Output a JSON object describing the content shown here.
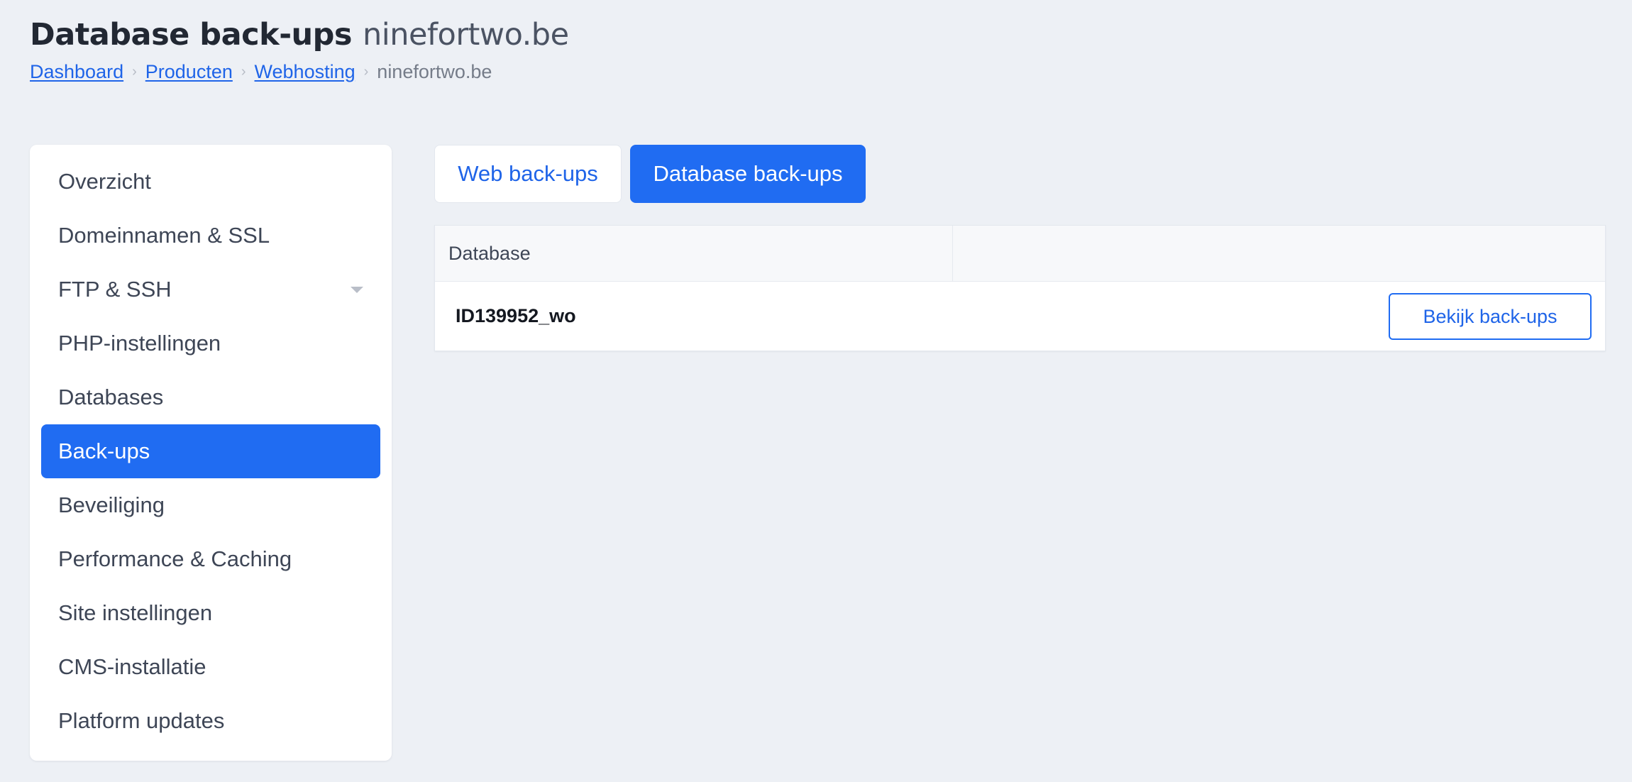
{
  "header": {
    "title": "Database back-ups",
    "domain": "ninefortwo.be"
  },
  "breadcrumb": {
    "items": [
      "Dashboard",
      "Producten",
      "Webhosting"
    ],
    "current": "ninefortwo.be",
    "separator": "›"
  },
  "sidebar": {
    "items": [
      {
        "label": "Overzicht"
      },
      {
        "label": "Domeinnamen & SSL"
      },
      {
        "label": "FTP & SSH",
        "has_dropdown": true
      },
      {
        "label": "PHP-instellingen"
      },
      {
        "label": "Databases"
      },
      {
        "label": "Back-ups",
        "active": true
      },
      {
        "label": "Beveiliging"
      },
      {
        "label": "Performance & Caching"
      },
      {
        "label": "Site instellingen"
      },
      {
        "label": "CMS-installatie"
      },
      {
        "label": "Platform updates"
      }
    ]
  },
  "tabs": [
    {
      "label": "Web back-ups",
      "active": false
    },
    {
      "label": "Database back-ups",
      "active": true
    }
  ],
  "table": {
    "columns": [
      "Database",
      ""
    ],
    "rows": [
      {
        "name": "ID139952_wo",
        "action_label": "Bekijk back-ups"
      }
    ]
  },
  "colors": {
    "accent": "#206cf2",
    "link": "#1f64e8",
    "background": "#edf0f5",
    "text": "#3e4656"
  }
}
